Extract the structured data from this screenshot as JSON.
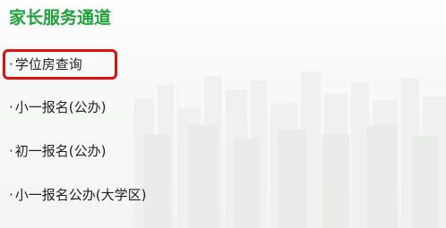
{
  "header": {
    "title": "家长服务通道"
  },
  "menu": {
    "bullet": "·",
    "items": [
      {
        "label": "学位房查询",
        "highlighted": true
      },
      {
        "label": "小一报名(公办)",
        "highlighted": false
      },
      {
        "label": "初一报名(公办)",
        "highlighted": false
      },
      {
        "label": "小一报名公办(大学区)",
        "highlighted": false
      }
    ]
  },
  "colors": {
    "title": "#1fa33a",
    "text": "#222222",
    "highlight_border": "#e01010"
  }
}
